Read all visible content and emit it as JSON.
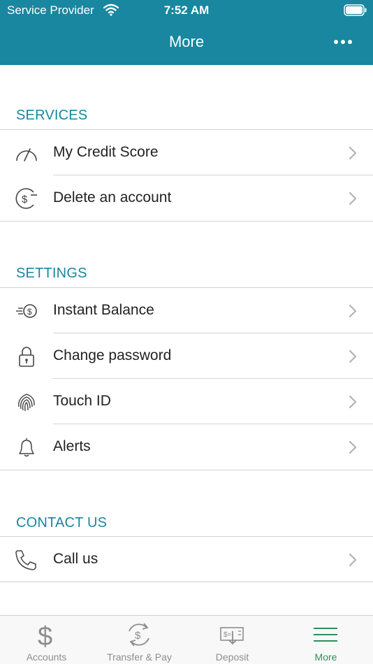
{
  "status_bar": {
    "carrier": "Service Provider",
    "time": "7:52 AM"
  },
  "nav": {
    "title": "More"
  },
  "sections": [
    {
      "title": "SERVICES",
      "items": [
        {
          "label": "My Credit Score",
          "icon": "gauge-icon"
        },
        {
          "label": "Delete an account",
          "icon": "dollar-minus-icon"
        }
      ]
    },
    {
      "title": "SETTINGS",
      "items": [
        {
          "label": "Instant Balance",
          "icon": "dollar-coin-fast-icon"
        },
        {
          "label": "Change password",
          "icon": "lock-icon"
        },
        {
          "label": "Touch ID",
          "icon": "fingerprint-icon"
        },
        {
          "label": "Alerts",
          "icon": "bell-icon"
        }
      ]
    },
    {
      "title": "CONTACT US",
      "items": [
        {
          "label": "Call us",
          "icon": "phone-icon"
        }
      ]
    }
  ],
  "tab_bar": {
    "tabs": [
      {
        "label": "Accounts",
        "icon": "dollar-icon",
        "active": false
      },
      {
        "label": "Transfer & Pay",
        "icon": "transfer-icon",
        "active": false
      },
      {
        "label": "Deposit",
        "icon": "check-deposit-icon",
        "active": false
      },
      {
        "label": "More",
        "icon": "hamburger-icon",
        "active": true
      }
    ]
  },
  "colors": {
    "header": "#18879f",
    "section_title": "#18879f",
    "active_tab": "#2f8f5b",
    "inactive_tab": "#8e8e8e"
  }
}
